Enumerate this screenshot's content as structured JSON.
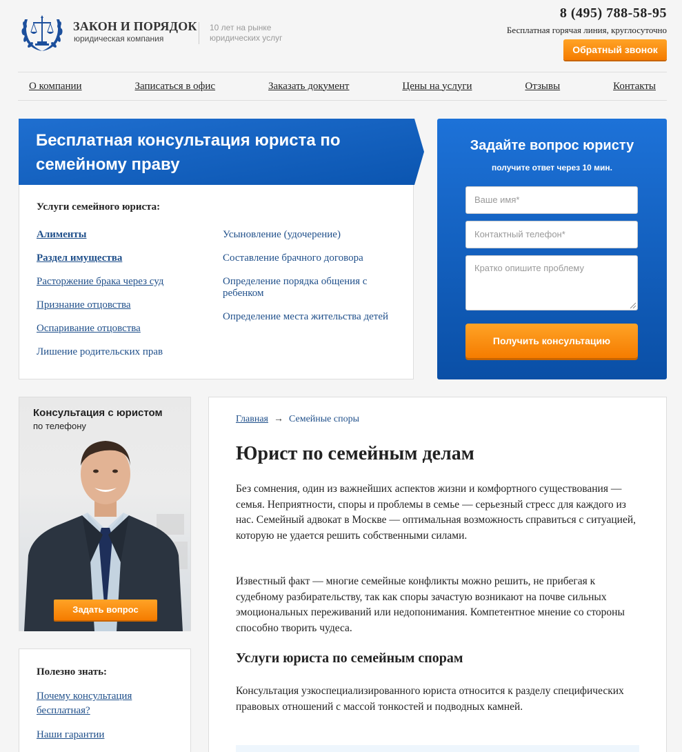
{
  "header": {
    "brand_title": "ЗАКОН И ПОРЯДОК",
    "brand_subtitle": "юридическая компания",
    "tagline": "10 лет на рынке юридических услуг",
    "phone": "8 (495) 788-58-95",
    "hotline": "Бесплатная горячая линия, круглосуточно",
    "callback_label": "Обратный звонок"
  },
  "nav": {
    "items": [
      "О компании",
      "Записаться в офис",
      "Заказать документ",
      "Цены на услуги",
      "Отзывы",
      "Контакты"
    ]
  },
  "hero": {
    "title": "Бесплатная консультация юриста по семейному праву",
    "services_title": "Услуги семейного юриста:",
    "services_left": [
      "Алименты",
      "Раздел имущества",
      "Расторжение брака через суд",
      "Признание отцовства",
      "Оспаривание отцовства",
      "Лишение родительских прав"
    ],
    "services_right": [
      "Усыновление (удочерение)",
      "Составление брачного договора",
      "Определение порядка общения с ребенком",
      "Определение места жительства детей"
    ]
  },
  "form": {
    "title": "Задайте вопрос юристу",
    "subtitle": "получите ответ через 10 мин.",
    "name_placeholder": "Ваше имя*",
    "phone_placeholder": "Контактный телефон*",
    "problem_placeholder": "Кратко опишите проблему",
    "submit_label": "Получить консультацию",
    "accent_color": "#f57c00",
    "panel_color": "#1666c4"
  },
  "consult": {
    "title": "Консультация с юристом",
    "subtitle": "по телефону",
    "ask_label": "Задать вопрос"
  },
  "useful": {
    "title": "Полезно знать:",
    "links": [
      "Почему консультация бесплатная?",
      "Наши гарантии"
    ]
  },
  "article": {
    "breadcrumb_home": "Главная",
    "breadcrumb_current": "Семейные споры",
    "title": "Юрист по семейным делам",
    "p1": "Без сомнения, один из важнейших аспектов жизни и комфортного существования — семья. Неприятности, споры и проблемы в семье — серьезный стресс для каждого из нас. Семейный адвокат в Москве — оптимальная возможность справиться с ситуацией, которую не удается решить собственными силами.",
    "p2": "Известный факт — многие семейные конфликты можно решить, не прибегая к судебному разбирательству, так как споры зачастую возникают на почве сильных эмоциональных переживаний или недопонимания. Компетентное мнение со стороны способно творить чудеса.",
    "h2": "Услуги юриста по семейным спорам",
    "p3": "Консультация узкоспециализированного юриста относится к разделу специфических правовых отношений с массой тонкостей и подводных камней."
  }
}
